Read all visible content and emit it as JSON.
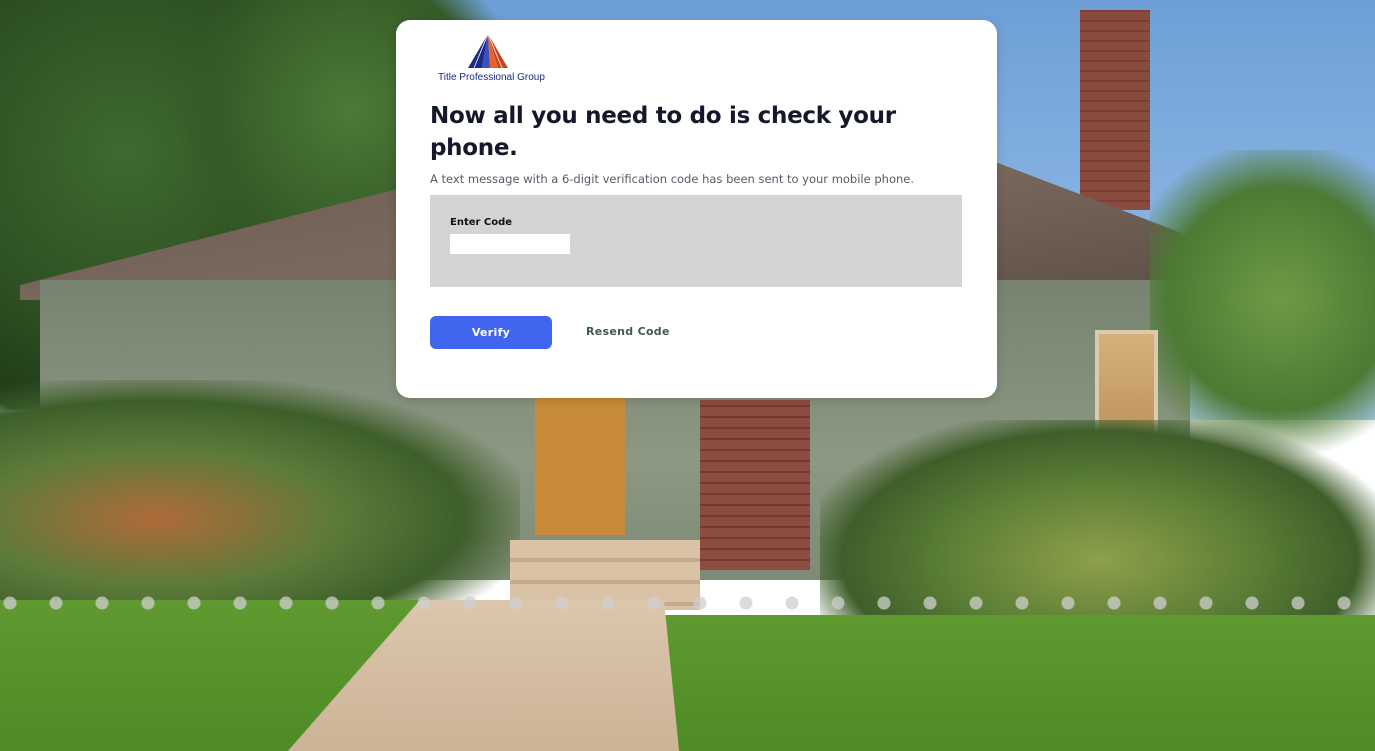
{
  "brand": {
    "name": "Title Professional Group",
    "logo_icon": "triangle-rays-logo-icon",
    "colors": {
      "logo_blue": "#1b2a87",
      "logo_orange": "#e8622c"
    }
  },
  "verification": {
    "title": "Now all you need to do is check your phone.",
    "subtitle": "A text message with a 6-digit verification code has been sent to your mobile phone.",
    "code_label": "Enter Code",
    "code_value": "",
    "code_placeholder": ""
  },
  "actions": {
    "verify_label": "Verify",
    "resend_label": "Resend Code"
  },
  "colors": {
    "primary_button": "#4265f0",
    "panel_background": "#d4d4d4",
    "link_text": "#3d5a4a"
  }
}
